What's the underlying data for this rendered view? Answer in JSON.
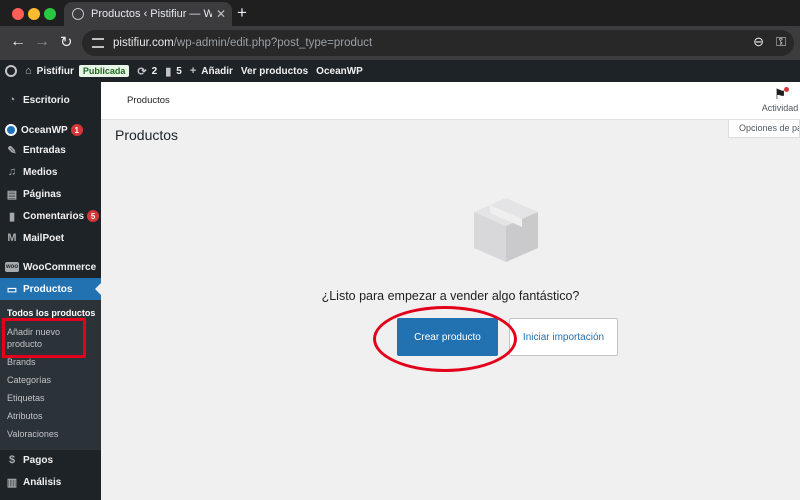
{
  "browser": {
    "tab_title": "Productos ‹ Pistifiur — WordPress",
    "new_tab_icon": "+",
    "url_domain": "pistifiur.com",
    "url_path": "/wp-admin/edit.php?post_type=product"
  },
  "adminbar": {
    "site_name": "Pistifiur",
    "status_badge": "Publicada",
    "updates_count": "2",
    "comments_count": "5",
    "add_new": "Añadir",
    "view_products": "Ver productos",
    "theme": "OceanWP"
  },
  "sidebar": {
    "items": [
      {
        "label": "Escritorio",
        "icon": "dashboard-icon"
      },
      {
        "label": "OceanWP",
        "badge": "1",
        "icon": "oceanwp-icon"
      },
      {
        "label": "Entradas",
        "icon": "pin-icon"
      },
      {
        "label": "Medios",
        "icon": "media-icon"
      },
      {
        "label": "Páginas",
        "icon": "page-icon"
      },
      {
        "label": "Comentarios",
        "badge": "5",
        "icon": "comment-icon"
      },
      {
        "label": "MailPoet",
        "icon": "mailpoet-icon"
      },
      {
        "label": "WooCommerce",
        "icon": "woo-icon"
      },
      {
        "label": "Productos",
        "icon": "archive-icon"
      },
      {
        "label": "Pagos",
        "icon": "payments-icon"
      },
      {
        "label": "Análisis",
        "icon": "chart-icon"
      }
    ],
    "woo_icon_text": "woo",
    "submenu": [
      "Todos los productos",
      "Añadir nuevo producto",
      "Brands",
      "Categorías",
      "Etiquetas",
      "Atributos",
      "Valoraciones"
    ]
  },
  "header": {
    "title": "Productos",
    "activity": "Actividad",
    "screen_options": "Opciones de pantalla"
  },
  "main": {
    "page_title": "Productos",
    "empty_heading": "¿Listo para empezar a vender algo fantástico?",
    "create_button": "Crear producto",
    "import_button": "Iniciar importación"
  },
  "colors": {
    "admin_dark": "#1d2327",
    "accent": "#2271b1",
    "annotation": "#e3001b",
    "badge": "#d63638"
  }
}
